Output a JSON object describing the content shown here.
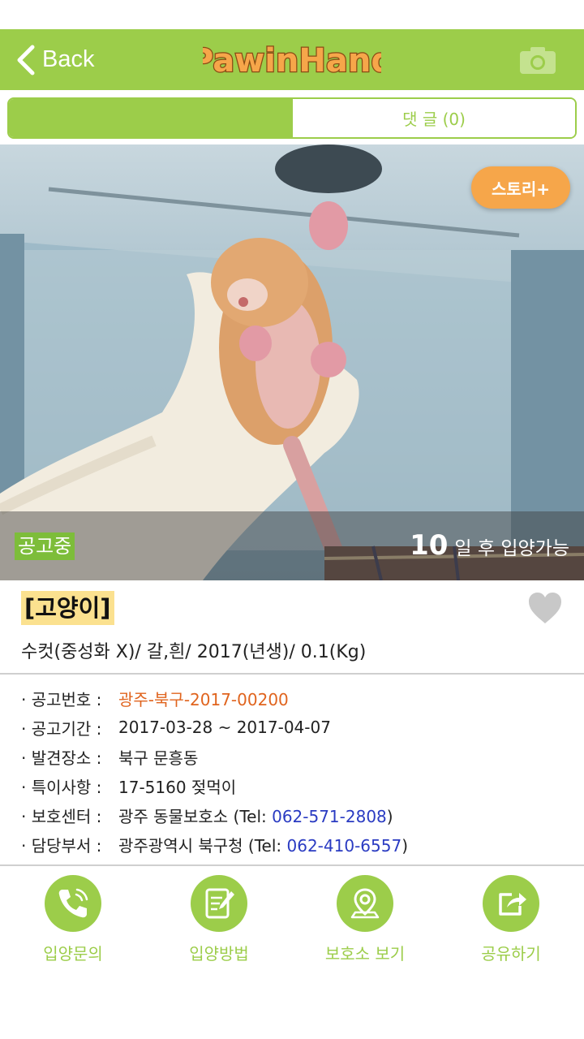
{
  "nav": {
    "back_label": "Back",
    "logo_text": "PawinHand"
  },
  "tabs": {
    "info_label": "",
    "comments_label": "댓 글 (0)"
  },
  "photo": {
    "story_button": "스토리+",
    "status_tag": "공고중",
    "days_number": "10",
    "days_text": "일 후 입양가능"
  },
  "pet": {
    "type": "[고양이]",
    "summary": "수컷(중성화 X)/ 갈,흰/ 2017(년생)/ 0.1(Kg)"
  },
  "details": [
    {
      "label": "· 공고번호 :",
      "value": "광주-북구-2017-00200"
    },
    {
      "label": "· 공고기간 :",
      "value": "2017-03-28 ~ 2017-04-07"
    },
    {
      "label": "· 발견장소 :",
      "value": "북구 문흥동"
    },
    {
      "label": "· 특이사항 :",
      "value": "17-5160 젖먹이"
    },
    {
      "label": "· 보호센터 :",
      "value_prefix": "광주 동물보호소 (Tel: ",
      "phone": "062-571-2808",
      "value_suffix": ")"
    },
    {
      "label": "· 담당부서 :",
      "value_prefix": "광주광역시 북구청 (Tel: ",
      "phone": "062-410-6557",
      "value_suffix": ")"
    }
  ],
  "actions": [
    {
      "label": "입양문의",
      "icon": "phone-icon"
    },
    {
      "label": "입양방법",
      "icon": "notepad-icon"
    },
    {
      "label": "보호소 보기",
      "icon": "map-pin-icon"
    },
    {
      "label": "공유하기",
      "icon": "share-icon"
    }
  ],
  "colors": {
    "brand_green": "#9ccd4a",
    "story_orange": "#f6a64a",
    "notice_orange": "#e0641e",
    "phone_blue": "#2a3bc2",
    "type_highlight": "#fbe18f"
  }
}
